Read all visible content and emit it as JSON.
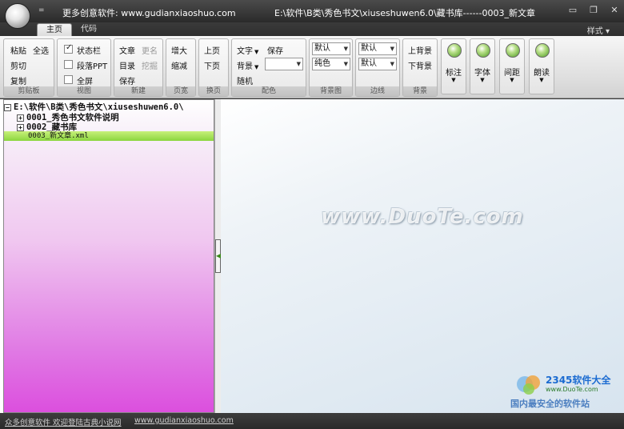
{
  "titlebar": {
    "app": "更多创意软件: www.gudianxiaoshuo.com",
    "path": "E:\\软件\\B类\\秀色书文\\xiuseshuwen6.0\\藏书库------0003_新文章",
    "minimize": "▭",
    "restore": "❐",
    "close": "✕",
    "quick_access": "="
  },
  "tabs": [
    {
      "label": "主页",
      "active": true
    },
    {
      "label": "代码",
      "active": false
    }
  ],
  "style_menu": "样式 ▾",
  "ribbon": {
    "clipboard": {
      "paste": "粘贴",
      "select_all": "全选",
      "cut": "剪切",
      "copy": "复制",
      "label": "剪贴板"
    },
    "view": {
      "statusbar": "状态栏",
      "statusbar_checked": true,
      "paragraph_ppt": "段落PPT",
      "paragraph_checked": false,
      "fullscreen": "全屏",
      "fullscreen_checked": false,
      "label": "视图"
    },
    "new": {
      "article": "文章",
      "rename": "更名",
      "catalog": "目录",
      "dig": "挖掘",
      "save": "保存",
      "label": "新建"
    },
    "page": {
      "enlarge": "增大",
      "shrink": "缩减",
      "label": "页宽"
    },
    "turn": {
      "prev": "上页",
      "next": "下页",
      "label": "换页"
    },
    "color": {
      "text": "文字",
      "save": "保存",
      "background": "背景",
      "random": "随机",
      "label": "配色"
    },
    "bgimg": {
      "combo1": "默认",
      "combo2": "纯色",
      "label": "背景图"
    },
    "border": {
      "combo1": "默认",
      "combo2": "默认",
      "label": "边线"
    },
    "bg": {
      "prev": "上背景",
      "next": "下背景",
      "label": "背景"
    },
    "big": [
      {
        "label": "标注"
      },
      {
        "label": "字体"
      },
      {
        "label": "间距"
      },
      {
        "label": "朗读"
      }
    ]
  },
  "tree": {
    "root": "E:\\软件\\B类\\秀色书文\\xiuseshuwen6.0\\",
    "items": [
      "0001_秀色书文软件说明",
      "0002_藏书库"
    ],
    "selected": "0003_新文章.xml"
  },
  "editor": {
    "watermark": "www.DuoTe.com",
    "logo_brand": "2345软件大全",
    "logo_url": "www.DuoTe.com",
    "logo_slogan": "国内最安全的软件站"
  },
  "status": {
    "left": "众多创意软件 欢迎登陆古典小说网",
    "right": "www.gudianxiaoshuo.com"
  },
  "colors": {
    "tree_selected": "#8bd63f",
    "accent": "#4c9a1f"
  }
}
